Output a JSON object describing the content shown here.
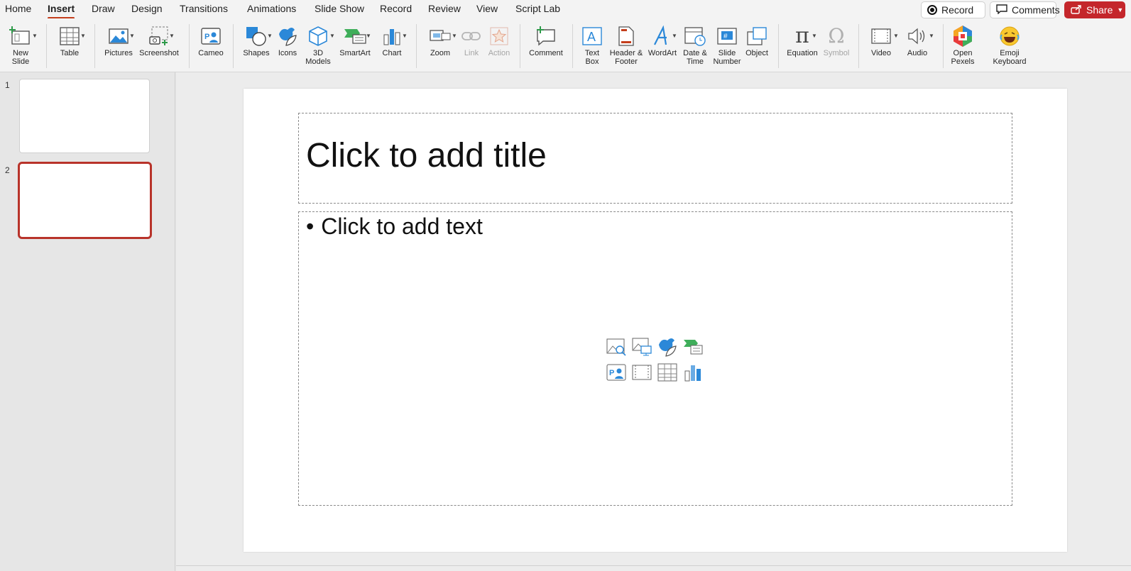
{
  "tabs": [
    {
      "label": "Home"
    },
    {
      "label": "Insert",
      "active": true
    },
    {
      "label": "Draw"
    },
    {
      "label": "Design"
    },
    {
      "label": "Transitions"
    },
    {
      "label": "Animations"
    },
    {
      "label": "Slide Show"
    },
    {
      "label": "Record"
    },
    {
      "label": "Review"
    },
    {
      "label": "View"
    },
    {
      "label": "Script Lab"
    }
  ],
  "topbar": {
    "record_label": "Record",
    "comments_label": "Comments",
    "share_label": "Share"
  },
  "ribbon": {
    "new_slide": "New\nSlide",
    "table": "Table",
    "pictures": "Pictures",
    "screenshot": "Screenshot",
    "cameo": "Cameo",
    "shapes": "Shapes",
    "icons": "Icons",
    "models3d": "3D\nModels",
    "smartart": "SmartArt",
    "chart": "Chart",
    "zoom": "Zoom",
    "link": "Link",
    "action": "Action",
    "comment": "Comment",
    "text_box": "Text\nBox",
    "header_footer": "Header &\nFooter",
    "wordart": "WordArt",
    "date_time": "Date &\nTime",
    "slide_number": "Slide\nNumber",
    "object": "Object",
    "equation": "Equation",
    "symbol": "Symbol",
    "video": "Video",
    "audio": "Audio",
    "open_pexels": "Open\nPexels",
    "emoji_keyboard": "Emoji\nKeyboard"
  },
  "sidebar": {
    "slides": [
      {
        "number": "1"
      },
      {
        "number": "2",
        "selected": true
      }
    ]
  },
  "slide": {
    "title_placeholder": "Click to add title",
    "body_placeholder": "Click to add text",
    "bullet": "•"
  },
  "colors": {
    "accent": "#c43e1c",
    "share": "#c4262b",
    "icon_blue": "#2b88d8"
  }
}
